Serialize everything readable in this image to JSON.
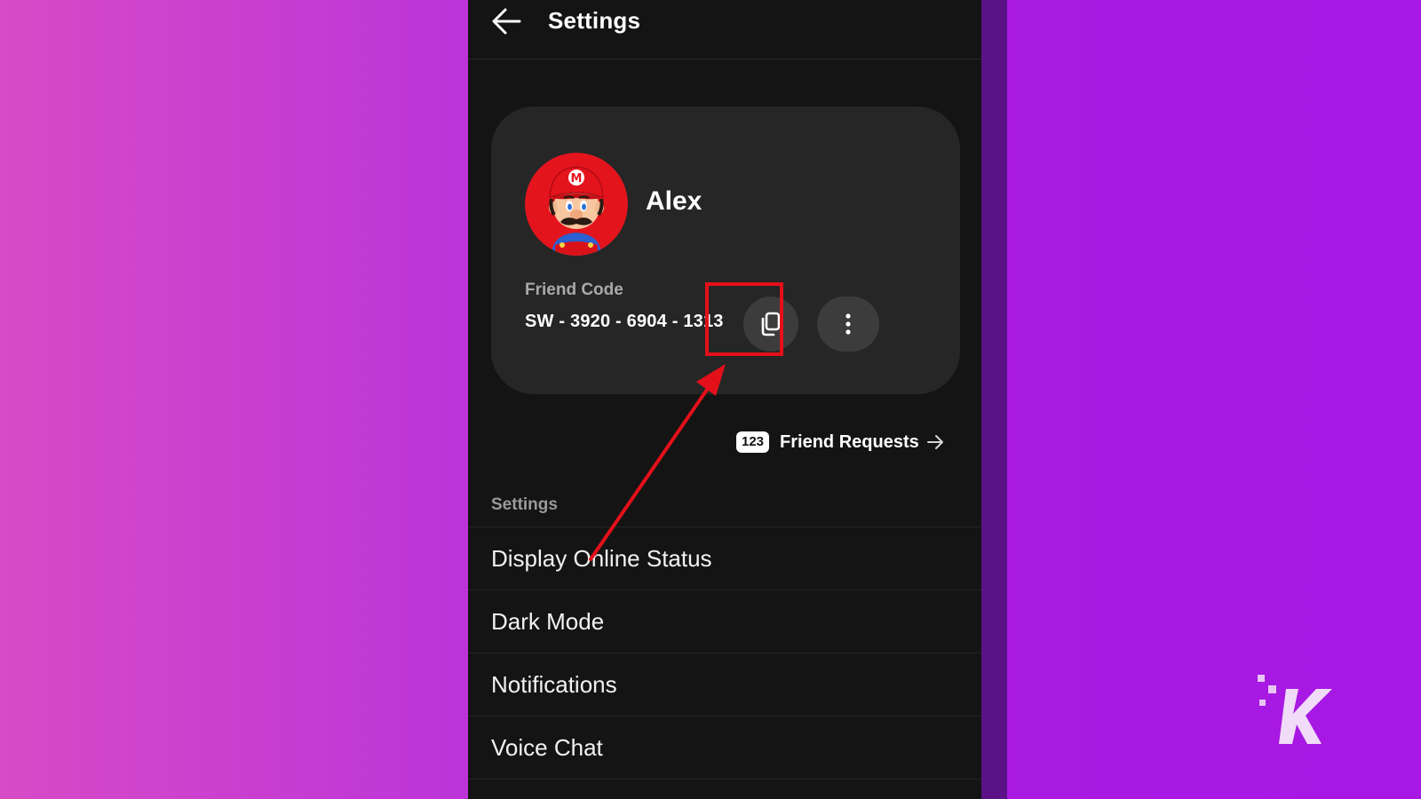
{
  "header": {
    "title": "Settings"
  },
  "profile": {
    "name": "Alex",
    "friend_code_label": "Friend Code",
    "friend_code": "SW - 3920 - 6904 - 1313"
  },
  "friend_requests": {
    "count": "123",
    "label": "Friend Requests"
  },
  "settings_section": {
    "label": "Settings",
    "items": [
      {
        "label": "Display Online Status"
      },
      {
        "label": "Dark Mode"
      },
      {
        "label": "Notifications"
      },
      {
        "label": "Voice Chat"
      }
    ]
  },
  "icons": {
    "back": "back-arrow-icon",
    "copy": "copy-icon",
    "more": "more-vertical-icon",
    "requests_arrow": "arrow-right-icon"
  },
  "colors": {
    "highlight": "#e3101a",
    "app_background": "#141414",
    "card_background": "#262626"
  }
}
